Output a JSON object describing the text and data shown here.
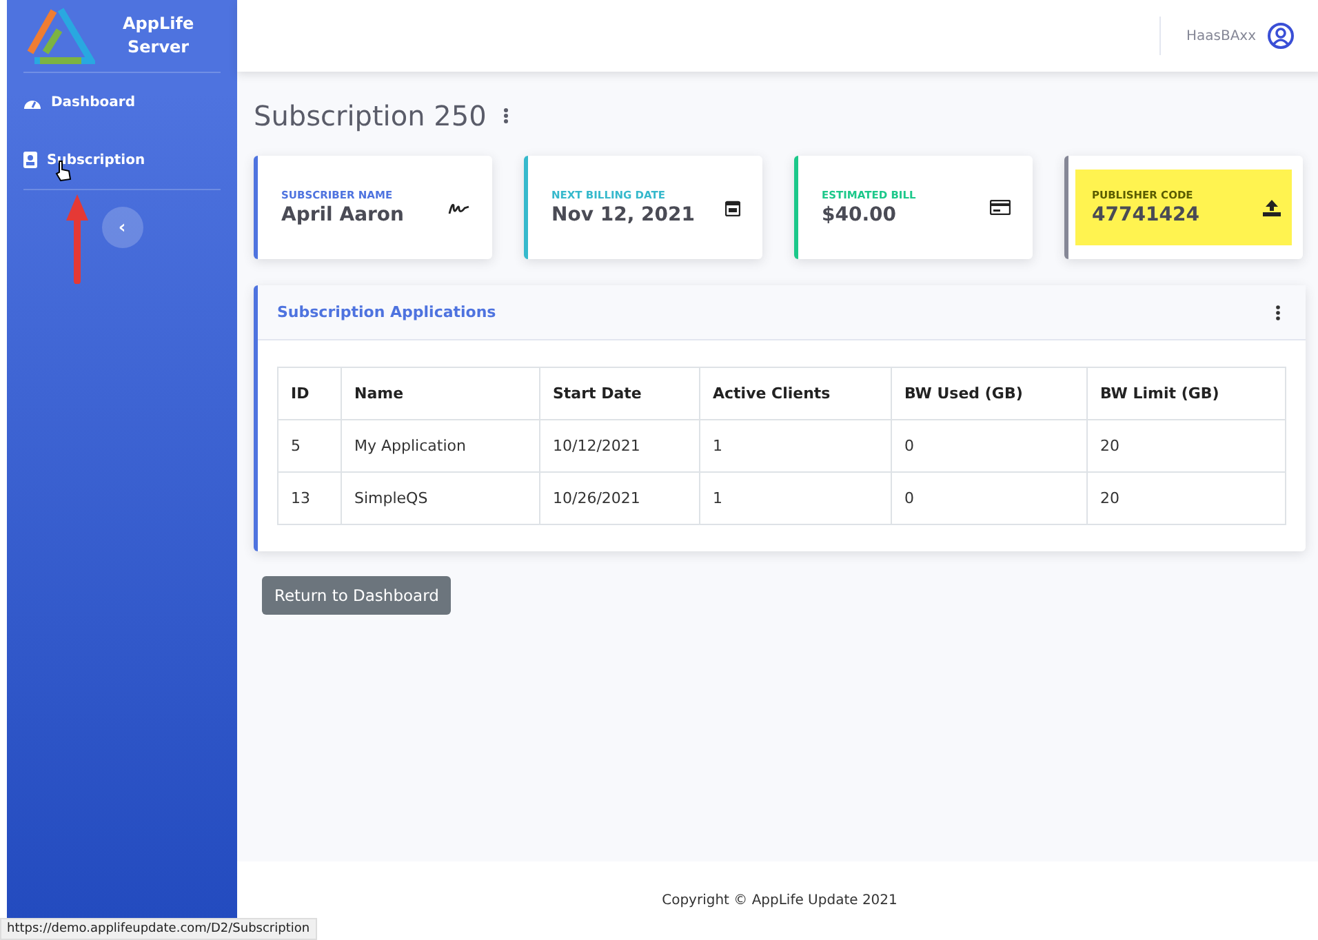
{
  "brand": {
    "line_1": "AppLife",
    "line_2": "Server"
  },
  "sidebar": {
    "items": [
      {
        "label": "Dashboard"
      },
      {
        "label": "Subscription"
      }
    ],
    "toggle": "‹"
  },
  "topbar": {
    "user": "HaasBAxx"
  },
  "page_title": "Subscription 250",
  "cards": [
    {
      "label": "SUBSCRIBER NAME",
      "value": "April Aaron",
      "color": "#4e73df",
      "highlighted": false
    },
    {
      "label": "NEXT BILLING DATE",
      "value": "Nov 12, 2021",
      "color": "#36b9cc",
      "highlighted": false
    },
    {
      "label": "ESTIMATED BILL",
      "value": "$40.00",
      "color": "#1cc88a",
      "highlighted": false
    },
    {
      "label": "PUBLISHER CODE",
      "value": "47741424",
      "color": "#858796",
      "highlighted": true
    }
  ],
  "panel": {
    "title": "Subscription Applications",
    "table": {
      "columns": [
        "ID",
        "Name",
        "Start Date",
        "Active Clients",
        "BW Used (GB)",
        "BW Limit (GB)"
      ],
      "rows": [
        [
          "5",
          "My Application",
          "10/12/2021",
          "1",
          "0",
          "20"
        ],
        [
          "13",
          "SimpleQS",
          "10/26/2021",
          "1",
          "0",
          "20"
        ]
      ]
    }
  },
  "return_button": "Return to Dashboard",
  "footer": "Copyright © AppLife Update 2021",
  "status_url": "https://demo.applifeupdate.com/D2/Subscription"
}
